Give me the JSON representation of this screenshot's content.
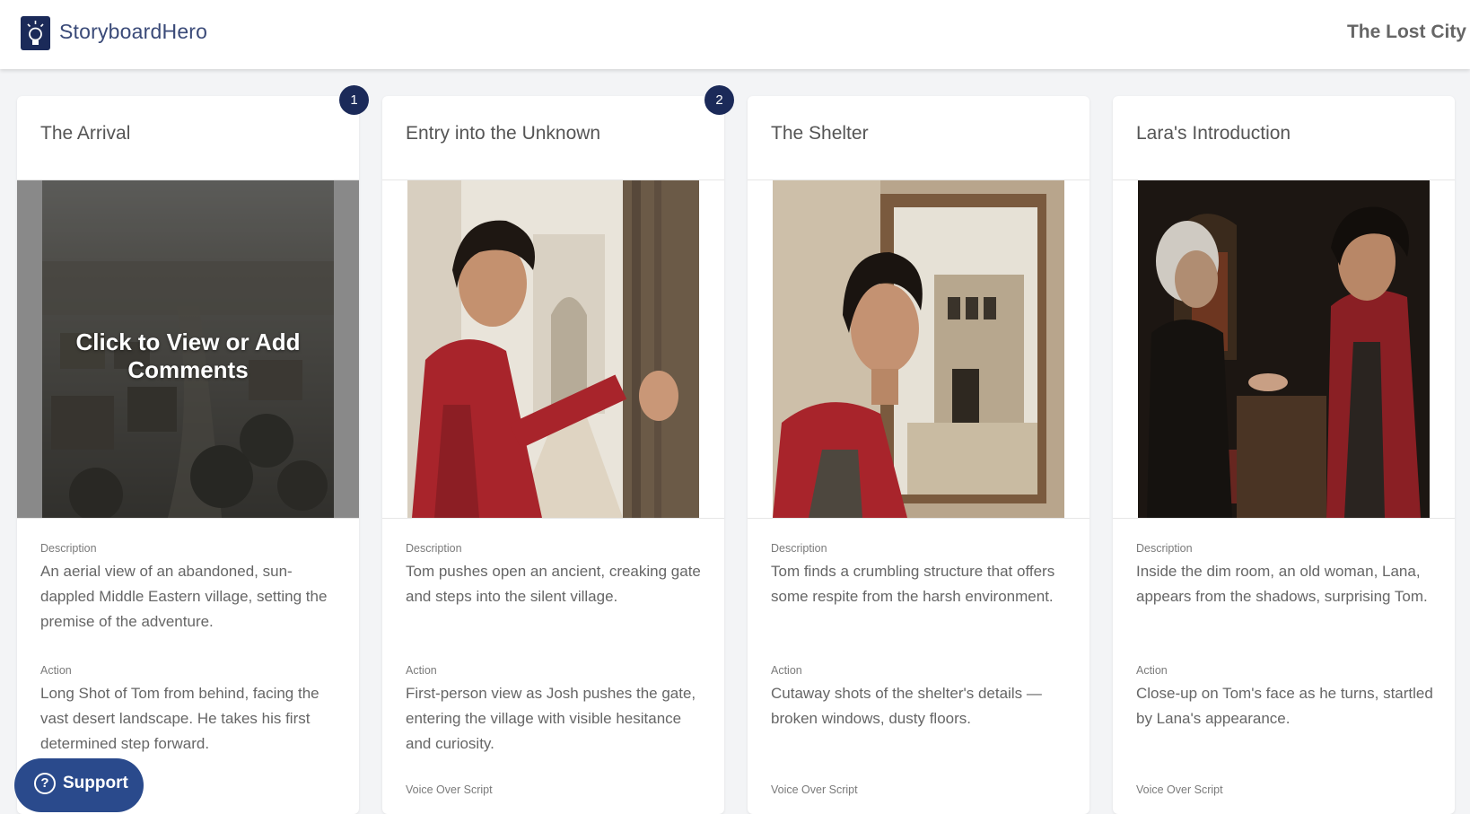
{
  "header": {
    "logo_text": "StoryboardHero",
    "logo_icon": "lightbulb-icon",
    "project_title": "The Lost City"
  },
  "labels": {
    "description": "Description",
    "action": "Action",
    "voice_over": "Voice Over Script"
  },
  "overlay_text": "Click to View or Add Comments",
  "support": {
    "label": "Support",
    "icon": "question-circle-icon"
  },
  "scenes": [
    {
      "title": "The Arrival",
      "badge": "1",
      "description": "An aerial view of an abandoned, sun-dappled Middle Eastern village, setting the premise of the adventure.",
      "action": "Long Shot of Tom from behind, facing the vast desert landscape. He takes his first determined step forward."
    },
    {
      "title": "Entry into the Unknown",
      "badge": "2",
      "description": "Tom pushes open an ancient, creaking gate and steps into the silent village.",
      "action": "First-person view as Josh pushes the gate, entering the village with visible hesitance and curiosity."
    },
    {
      "title": "The Shelter",
      "description": "Tom finds a crumbling structure that offers some respite from the harsh environment.",
      "action": "Cutaway shots of the shelter's details — broken windows, dusty floors."
    },
    {
      "title": "Lara's Introduction",
      "description": "Inside the dim room, an old woman, Lana, appears from the shadows, surprising Tom.",
      "action": "Close-up on Tom's face as he turns, startled by Lana's appearance."
    }
  ],
  "colors": {
    "brand_navy": "#1b2a59",
    "support_blue": "#2a4a8c",
    "shirt_red": "#a8242b"
  }
}
